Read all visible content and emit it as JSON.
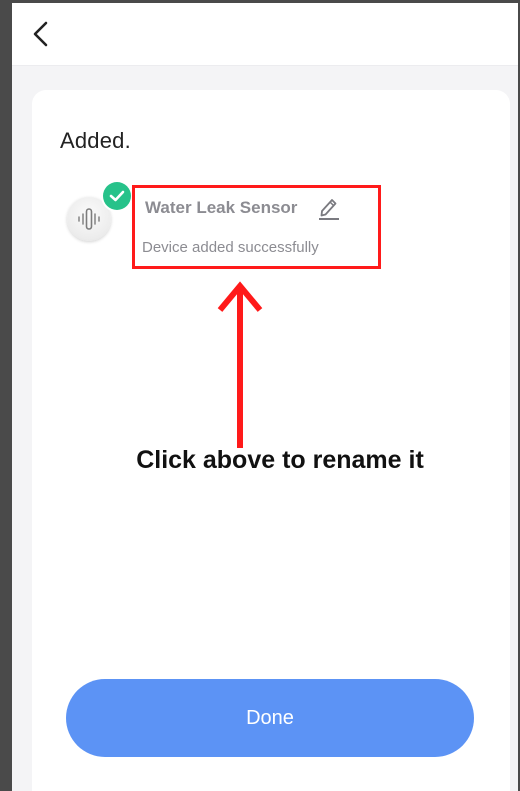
{
  "header": {
    "back_icon": "chevron-left-icon"
  },
  "main": {
    "title": "Added.",
    "device": {
      "name": "Water Leak Sensor",
      "status": "Device added successfully",
      "icon": "water-leak-sensor-icon",
      "badge_icon": "checkmark-icon",
      "edit_icon": "pencil-icon"
    },
    "annotation": "Click above to rename it",
    "done_label": "Done"
  },
  "colors": {
    "highlight_box": "#ff1a1a",
    "arrow": "#ff1a1a",
    "badge": "#27c28a",
    "done_button": "#5c93f5",
    "muted_text": "#8c8c92"
  }
}
